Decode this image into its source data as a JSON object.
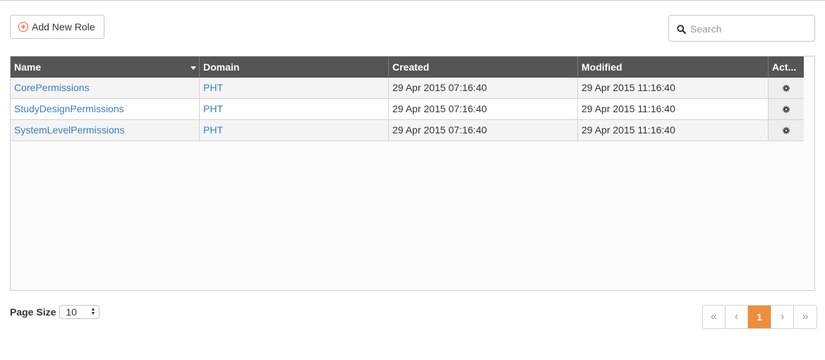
{
  "toolbar": {
    "add_label": "Add New Role",
    "search_placeholder": "Search"
  },
  "table": {
    "columns": [
      "Name",
      "Domain",
      "Created",
      "Modified",
      "Act..."
    ],
    "rows": [
      {
        "name": "CorePermissions",
        "domain": "PHT",
        "created": "29 Apr 2015 07:16:40",
        "modified": "29 Apr 2015 11:16:40"
      },
      {
        "name": "StudyDesignPermissions",
        "domain": "PHT",
        "created": "29 Apr 2015 07:16:40",
        "modified": "29 Apr 2015 11:16:40"
      },
      {
        "name": "SystemLevelPermissions",
        "domain": "PHT",
        "created": "29 Apr 2015 07:16:40",
        "modified": "29 Apr 2015 11:16:40"
      }
    ]
  },
  "footer": {
    "page_size_label": "Page Size",
    "page_size_value": "10",
    "pager": {
      "first": "«",
      "prev": "‹",
      "current": "1",
      "next": "›",
      "last": "»"
    }
  },
  "colors": {
    "header_bg": "#555555",
    "link": "#3a7fc1",
    "accent": "#ee8d3c",
    "add_icon": "#e8643c"
  }
}
